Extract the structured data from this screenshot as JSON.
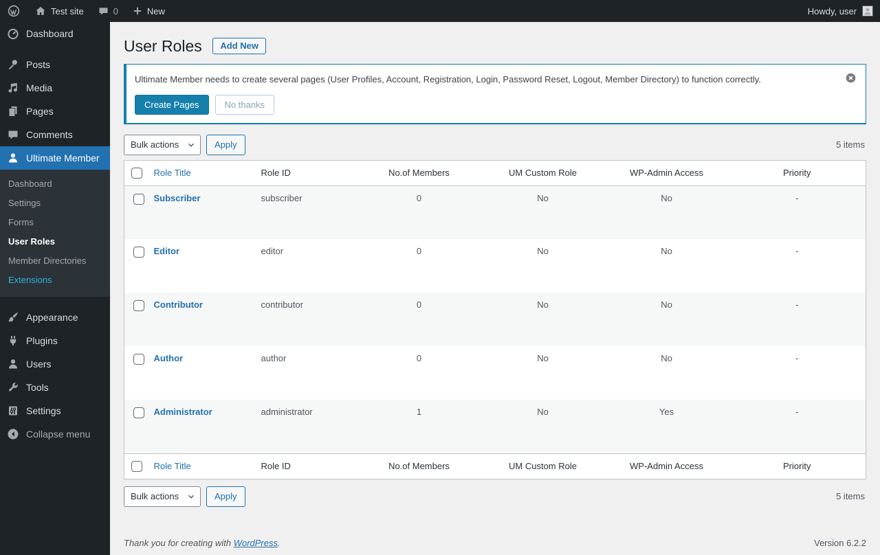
{
  "colors": {
    "accent_blue": "#2271b1",
    "um_teal": "#1580ab",
    "extensions_cyan": "#2db1dc",
    "sidebar_bg": "#1d2327",
    "submenu_bg": "#2c3338",
    "content_bg": "#f0f0f1",
    "alt_row_bg": "#f6f7f7",
    "table_border": "#c3c4c7"
  },
  "admin_bar": {
    "site_name": "Test site",
    "comments_count": "0",
    "new_label": "New",
    "howdy": "Howdy, user"
  },
  "sidebar": {
    "items": [
      {
        "label": "Dashboard"
      },
      {
        "label": "Posts"
      },
      {
        "label": "Media"
      },
      {
        "label": "Pages"
      },
      {
        "label": "Comments"
      },
      {
        "label": "Ultimate Member"
      },
      {
        "label": "Appearance"
      },
      {
        "label": "Plugins"
      },
      {
        "label": "Users"
      },
      {
        "label": "Tools"
      },
      {
        "label": "Settings"
      },
      {
        "label": "Collapse menu"
      }
    ],
    "um_submenu": [
      {
        "label": "Dashboard"
      },
      {
        "label": "Settings"
      },
      {
        "label": "Forms"
      },
      {
        "label": "User Roles"
      },
      {
        "label": "Member Directories"
      },
      {
        "label": "Extensions"
      }
    ]
  },
  "page": {
    "title": "User Roles",
    "add_new_label": "Add New"
  },
  "notice": {
    "message": "Ultimate Member needs to create several pages (User Profiles, Account, Registration, Login, Password Reset, Logout, Member Directory) to function correctly.",
    "create_pages_label": "Create Pages",
    "no_thanks_label": "No thanks"
  },
  "toolbar": {
    "bulk_actions_label": "Bulk actions",
    "apply_label": "Apply",
    "items_count": "5 items"
  },
  "table": {
    "columns": [
      "Role Title",
      "Role ID",
      "No.of Members",
      "UM Custom Role",
      "WP-Admin Access",
      "Priority"
    ],
    "rows": [
      {
        "title": "Subscriber",
        "role_id": "subscriber",
        "members": "0",
        "um_custom_role": "No",
        "wp_admin_access": "No",
        "priority": "-"
      },
      {
        "title": "Editor",
        "role_id": "editor",
        "members": "0",
        "um_custom_role": "No",
        "wp_admin_access": "No",
        "priority": "-"
      },
      {
        "title": "Contributor",
        "role_id": "contributor",
        "members": "0",
        "um_custom_role": "No",
        "wp_admin_access": "No",
        "priority": "-"
      },
      {
        "title": "Author",
        "role_id": "author",
        "members": "0",
        "um_custom_role": "No",
        "wp_admin_access": "No",
        "priority": "-"
      },
      {
        "title": "Administrator",
        "role_id": "administrator",
        "members": "1",
        "um_custom_role": "No",
        "wp_admin_access": "Yes",
        "priority": "-"
      }
    ]
  },
  "footer": {
    "thanks_prefix": "Thank you for creating with ",
    "wordpress_link": "WordPress",
    "thanks_suffix": ".",
    "version": "Version 6.2.2"
  }
}
